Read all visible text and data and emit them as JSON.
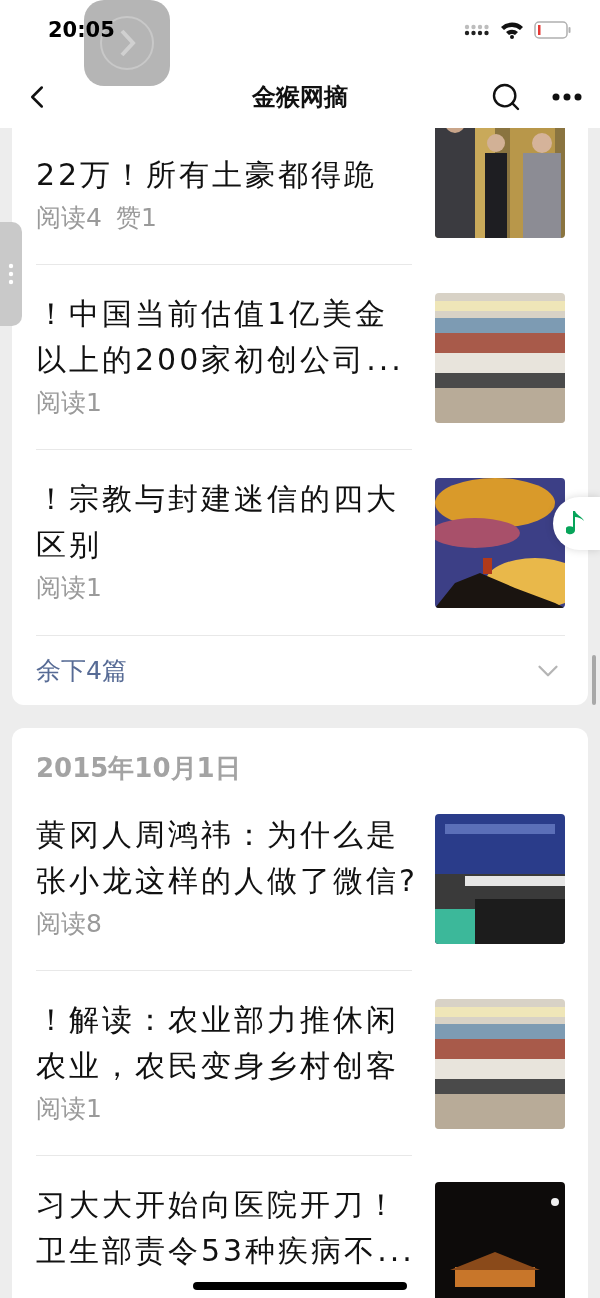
{
  "status_bar": {
    "time": "20:05"
  },
  "nav": {
    "title": "金猴网摘"
  },
  "groups": [
    {
      "articles": [
        {
          "title": "22万！所有土豪都得跪",
          "stats": [
            "阅读4",
            "赞1"
          ],
          "image": {
            "kind": "picture"
          }
        },
        {
          "title": "！中国当前估值1亿美金以上的200家初创公司...",
          "stats": [
            "阅读1"
          ],
          "image": {
            "kind": "picture"
          }
        },
        {
          "title": "！宗教与封建迷信的四大区别",
          "stats": [
            "阅读1"
          ],
          "image": {
            "kind": "picture"
          }
        }
      ],
      "more": "余下4篇"
    },
    {
      "date": "2015年10月1日",
      "articles": [
        {
          "title": "黄冈人周鸿祎：为什么是张小龙这样的人做了微信?",
          "stats": [
            "阅读8"
          ],
          "image": {
            "kind": "picture"
          }
        },
        {
          "title": "！解读：农业部力推休闲农业，农民变身乡村创客",
          "stats": [
            "阅读1"
          ],
          "image": {
            "kind": "picture"
          }
        },
        {
          "title": "习大大开始向医院开刀！卫生部责令53种疾病不...",
          "image": {
            "kind": "picture"
          }
        }
      ]
    }
  ]
}
